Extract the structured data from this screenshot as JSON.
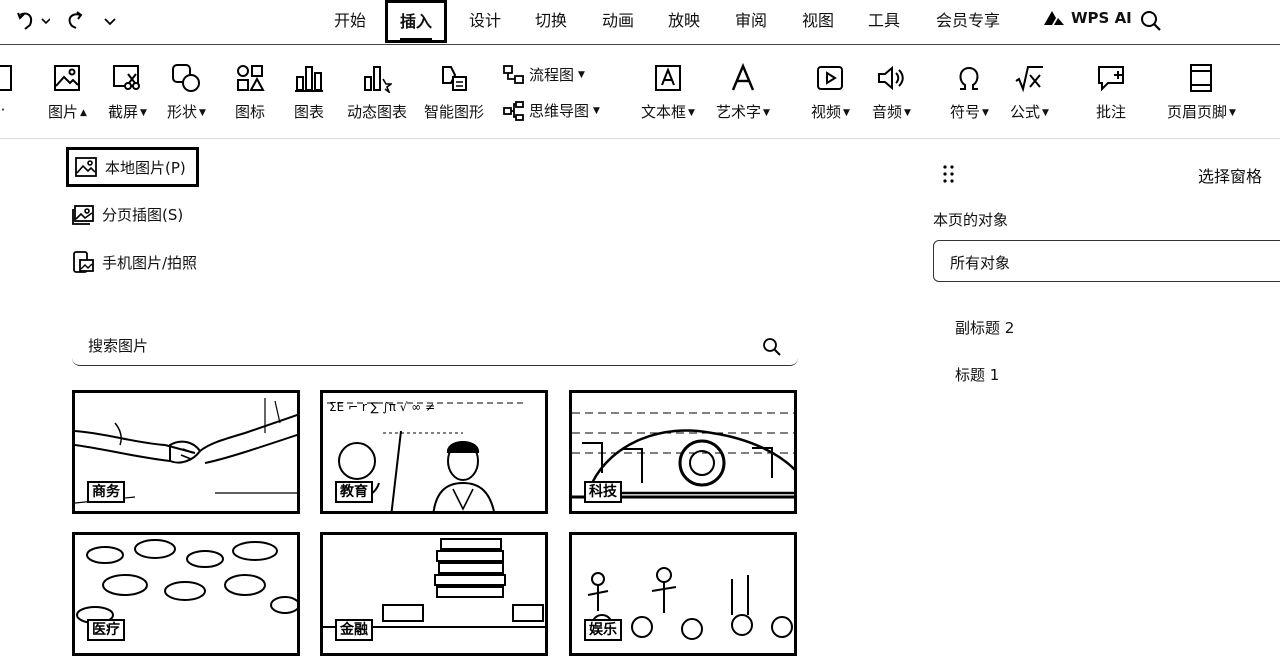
{
  "menu": {
    "tabs": [
      "开始",
      "插入",
      "设计",
      "切换",
      "动画",
      "放映",
      "审阅",
      "视图",
      "工具",
      "会员专享"
    ],
    "active_tab": "插入",
    "wps_ai": "WPS AI"
  },
  "ribbon": {
    "picture": "图片",
    "screenshot": "截屏",
    "shape": "形状",
    "icon": "图标",
    "chart": "图表",
    "dynamic_chart": "动态图表",
    "smart_graphic": "智能图形",
    "flowchart": "流程图",
    "mindmap": "思维导图",
    "textbox": "文本框",
    "wordart": "艺术字",
    "video": "视频",
    "audio": "音频",
    "symbol": "符号",
    "formula": "公式",
    "comment": "批注",
    "header_footer": "页眉页脚"
  },
  "picture_menu": {
    "options": [
      "本地图片(P)",
      "分页插图(S)",
      "手机图片/拍照"
    ],
    "search_placeholder": "搜索图片",
    "categories": [
      "商务",
      "教育",
      "科技",
      "医疗",
      "金融",
      "娱乐"
    ]
  },
  "selection_pane": {
    "title": "选择窗格",
    "objects_label": "本页的对象",
    "filter_value": "所有对象",
    "objects": [
      "副标题 2",
      "标题 1"
    ]
  }
}
